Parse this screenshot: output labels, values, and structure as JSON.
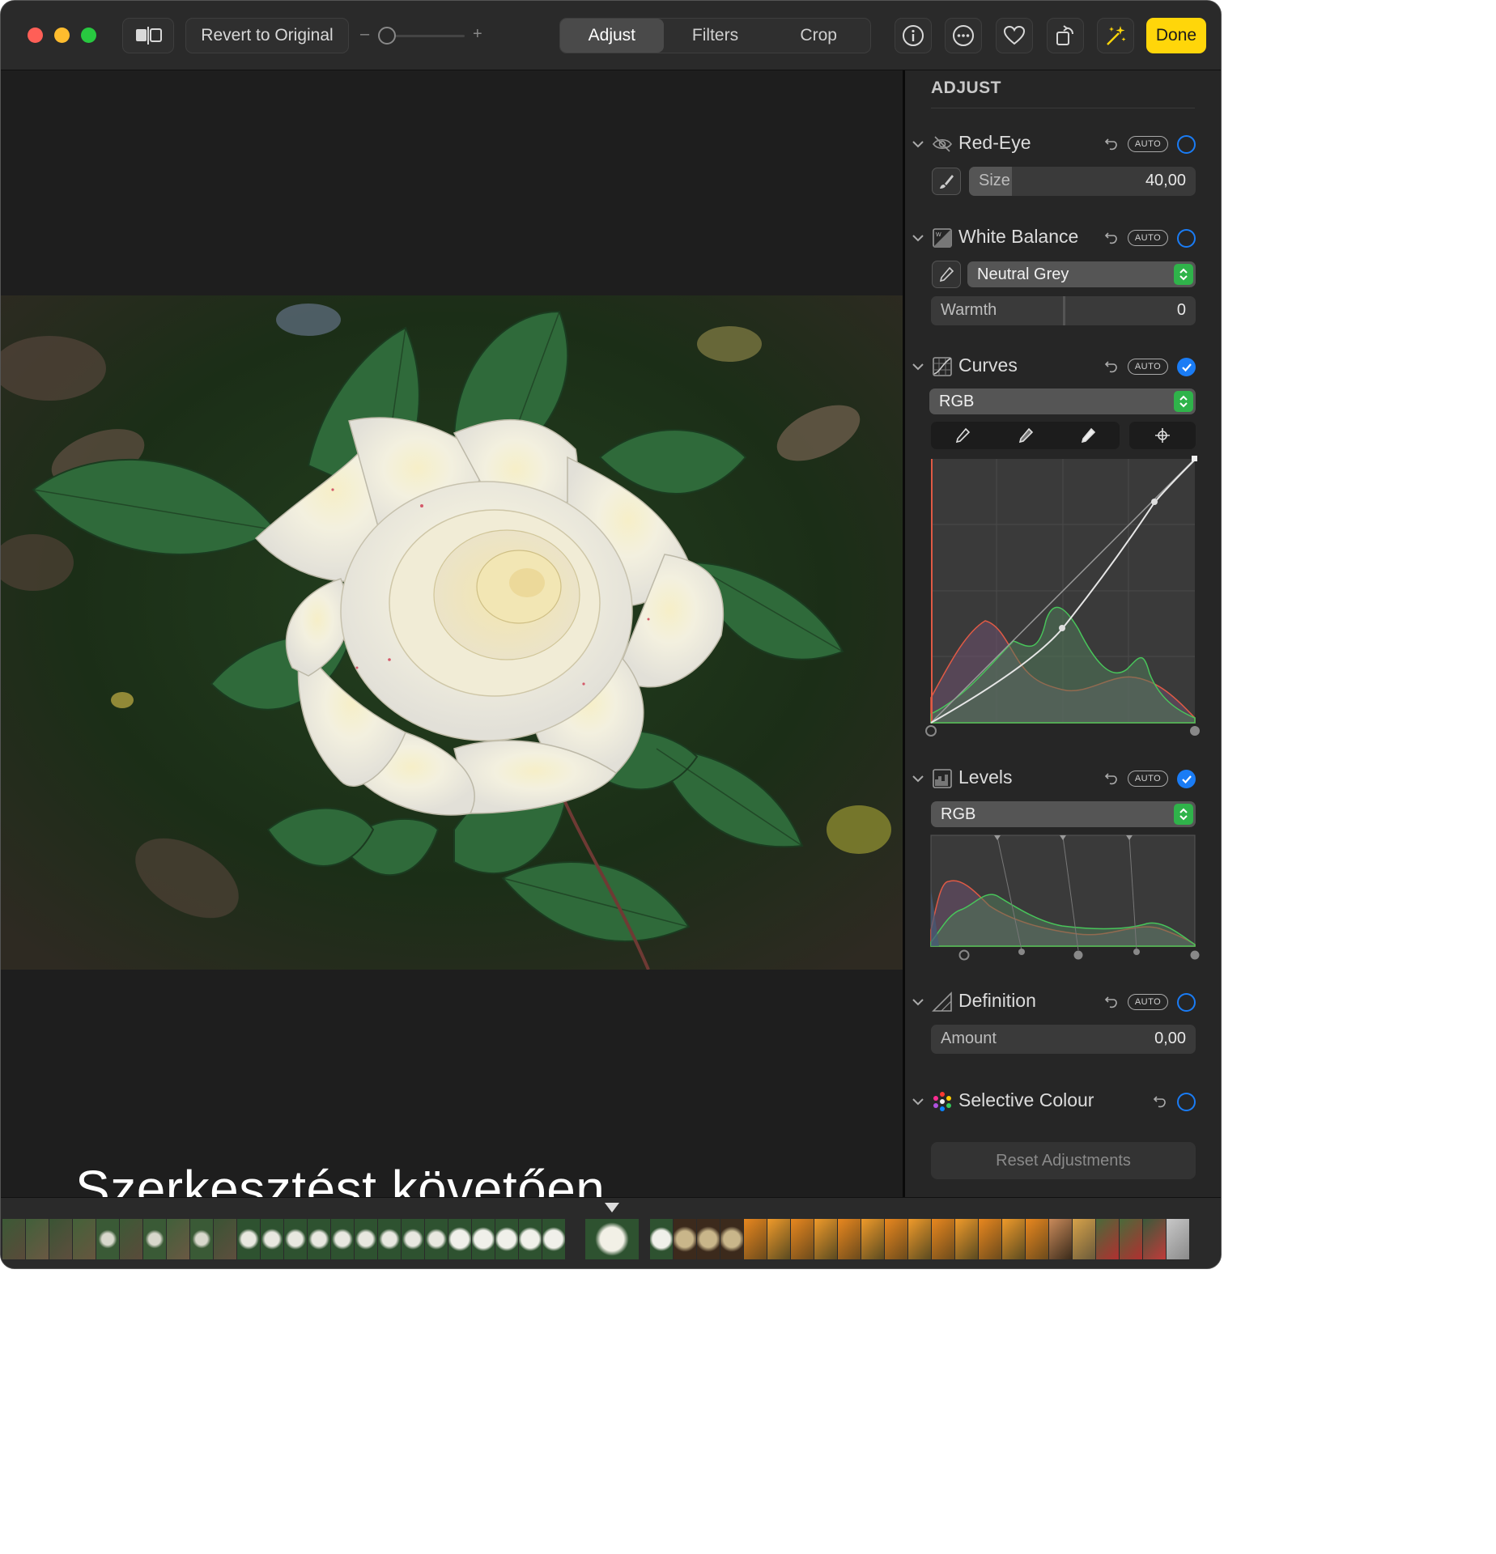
{
  "toolbar": {
    "revert_label": "Revert to Original",
    "slider_minus": "–",
    "slider_plus": "+",
    "tabs": [
      "Adjust",
      "Filters",
      "Crop"
    ],
    "active_tab": "Adjust",
    "done_label": "Done",
    "zoom_level": 0.0
  },
  "viewer": {
    "caption": "Szerkesztést követően"
  },
  "sidebar": {
    "title": "ADJUST",
    "auto_label": "AUTO",
    "red_eye": {
      "title": "Red-Eye",
      "size_label": "Size",
      "size_value": "40,00",
      "size_fraction": 0.19,
      "enabled": false
    },
    "white_balance": {
      "title": "White Balance",
      "mode": "Neutral Grey",
      "warmth_label": "Warmth",
      "warmth_value": "0",
      "warmth_fraction": 0.5,
      "enabled": false
    },
    "curves": {
      "title": "Curves",
      "channel": "RGB",
      "enabled": true
    },
    "levels": {
      "title": "Levels",
      "channel": "RGB",
      "enabled": true
    },
    "definition": {
      "title": "Definition",
      "amount_label": "Amount",
      "amount_value": "0,00",
      "enabled": false
    },
    "selective_colour": {
      "title": "Selective Colour",
      "enabled": false
    },
    "reset_label": "Reset Adjustments"
  },
  "colors": {
    "accent_blue": "#1a7cf5",
    "done_yellow": "#ffd60a",
    "stepper_green": "#2fb34a",
    "close_red": "#ff5f57",
    "minimize_yellow": "#febc2e",
    "zoom_green": "#28c840"
  }
}
